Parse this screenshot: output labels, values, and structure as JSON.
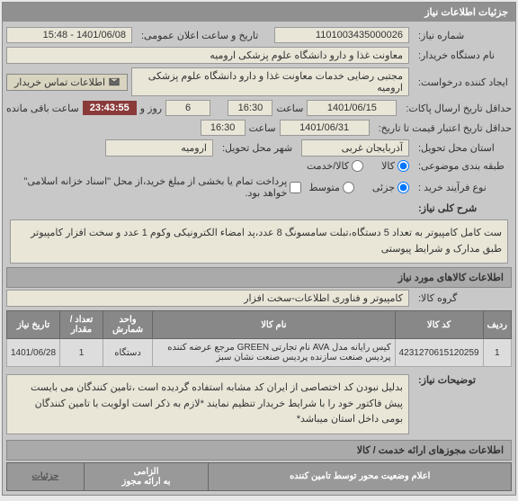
{
  "header": {
    "title": "جزئیات اطلاعات نیاز"
  },
  "fields": {
    "need_no_label": "شماره نیاز:",
    "need_no": "1101003435000026",
    "pub_datetime_label": "تاریخ و ساعت اعلان عمومی:",
    "pub_datetime": "1401/06/08 - 15:48",
    "buyer_org_label": "نام دستگاه خریدار:",
    "buyer_org": "معاونت غذا و دارو دانشگاه علوم پزشکی ارومیه",
    "requester_label": "ایجاد کننده درخواست:",
    "requester": "مجتبی رضایی خدمات معاونت غذا و دارو دانشگاه علوم پزشکی ارومیه",
    "contact_btn": "اطلاعات تماس خریدار",
    "deadline_send_label": "حداقل تاریخ ارسال پاکات:",
    "deadline_date": "1401/06/15",
    "time_label": "ساعت",
    "deadline_time": "16:30",
    "remaining_days": "6",
    "days_and": "روز و",
    "remaining_time": "23:43:55",
    "remaining_label": "ساعت باقی مانده",
    "validity_label": "حداقل تاریخ اعتبار قیمت تا تاریخ:",
    "validity_date": "1401/06/31",
    "validity_time": "16:30",
    "province_label": "استان محل تحویل:",
    "province": "آذربایجان غربی",
    "city_label": "شهر محل تحویل:",
    "city": "ارومیه",
    "category_label": "طبقه بندی موضوعی:",
    "cat_goods": "کالا",
    "cat_service": "کالا/خدمت",
    "process_label": "نوع فرآیند خرید :",
    "proc_partial": "جزئی",
    "proc_mid": "متوسط",
    "pay_note": "پرداخت تمام یا بخشی از مبلغ خرید،از محل \"اسناد خزانه اسلامی\" خواهد بود.",
    "summary_label": "شرح کلی نیاز:",
    "summary": "ست کامل کامپیوتر به تعداد 5 دستگاه،تبلت سامسونگ 8 عدد،پد امضاء الکترونیکی وکوم 1 عدد و سخت افزار کامپیوتر طبق مدارک و شرایط پیوستی",
    "goods_section": "اطلاعات کالاهای مورد نیاز",
    "group_label": "گروه کالا:",
    "group_value": "کامپیوتر و فناوری اطلاعات-سخت افزار",
    "table": {
      "headers": {
        "row": "ردیف",
        "code": "کد کالا",
        "name": "نام کالا",
        "unit": "واحد شمارش",
        "qty": "تعداد / مقدار",
        "date": "تاریخ نیاز"
      },
      "rows": [
        {
          "row": "1",
          "code": "4231270615120259",
          "name": "کیس رایانه مدل AVA نام تجارتی GREEN مرجع عرضه کننده پردیس صنعت سازنده پردیس صنعت نشان سبز",
          "unit": "دستگاه",
          "qty": "1",
          "date": "1401/06/28"
        }
      ]
    },
    "notice_label": "توضیحات نیاز:",
    "notice": "بدلیل نبودن کد اختصاصی از ایران کد مشابه استفاده گردیده است ،تامین کنندگان می بایست پیش فاکتور خود را با شرایط خریدار تنظیم نمایند *لازم به ذکر است اولویت با تامین کنندگان بومی داخل استان میباشد*",
    "licenses_section": "اطلاعات مجوزهای ارائه خدمت / کالا",
    "center_announce": "اعلام وضعیت محور توسط تامین کننده",
    "mandatory_label": "الزامی\nبه ارائه مجوز",
    "details": "جزئیات"
  }
}
